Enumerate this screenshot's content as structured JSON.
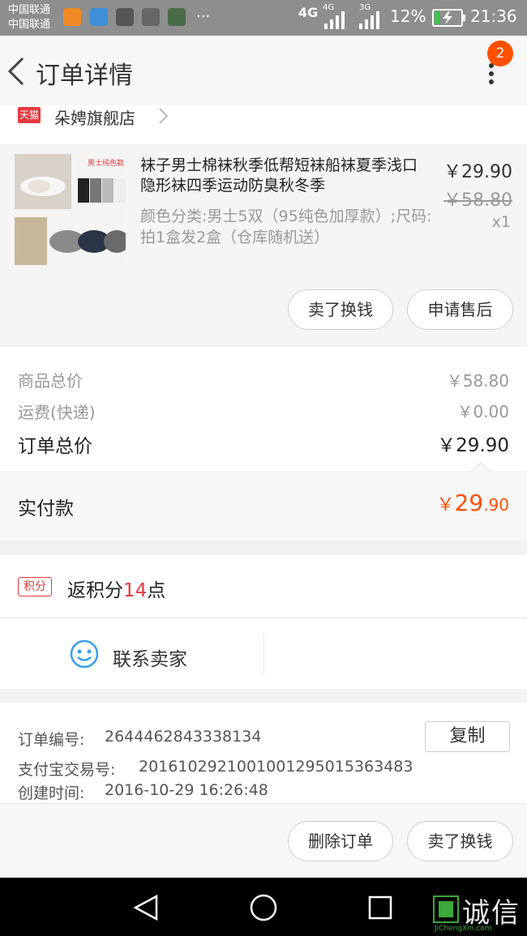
{
  "status_bar": {
    "carrier1": "中国联通",
    "carrier2": "中国联通",
    "more": "···",
    "net1": "4G",
    "net2": "4G",
    "net3": "3G",
    "battery": "12%",
    "time": "21:36"
  },
  "header": {
    "title": "订单详情",
    "badge_count": "2"
  },
  "shop": {
    "tag": "天猫",
    "name": "朵娉旗舰店"
  },
  "product": {
    "title": "袜子男士棉袜秋季低帮短袜船袜夏季浅口隐形袜四季运动防臭秋冬季",
    "sku": "颜色分类:男士5双（95纯色加厚款）;尺码:拍1盒发2盒（仓库随机送）",
    "price": "￥29.90",
    "original_price": "￥58.80",
    "quantity": "x1",
    "image_text": "男士纯色款",
    "buttons": {
      "sell": "卖了换钱",
      "after_sale": "申请售后"
    }
  },
  "summary": {
    "goods_label": "商品总价",
    "goods_value": "￥58.80",
    "shipping_label": "运费(快递)",
    "shipping_value": "￥0.00",
    "total_label": "订单总价",
    "total_value": "￥29.90",
    "paid_label": "实付款",
    "paid_symbol": "￥",
    "paid_int": "29",
    "paid_dec": ".90"
  },
  "points": {
    "tag": "积分",
    "prefix": "返积分",
    "count": "14",
    "suffix": "点"
  },
  "contact": {
    "label": "联系卖家"
  },
  "order_info": {
    "number_label": "订单编号:",
    "number": "2644462843338134",
    "copy": "复制",
    "alipay_label": "支付宝交易号:",
    "alipay": "2016102921001001295015363483",
    "created_label": "创建时间:",
    "created": "2016-10-29 16:26:48"
  },
  "footer": {
    "delete": "删除订单",
    "sell": "卖了换钱"
  },
  "watermark": {
    "text": "诚信",
    "sub": "JiChengXin.com"
  },
  "colors": {
    "accent": "#ff5000",
    "points": "#e4393c",
    "contact_icon": "#3a9fe8"
  }
}
